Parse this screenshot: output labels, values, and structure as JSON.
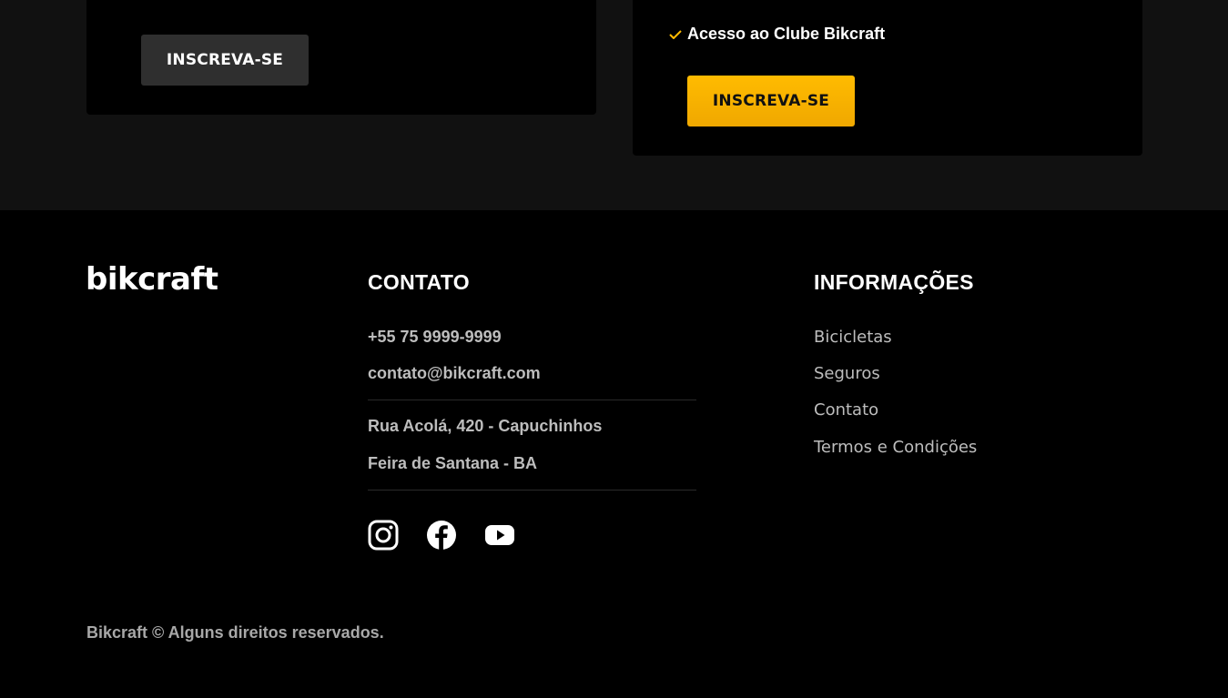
{
  "plans": {
    "left_button": "INSCREVA-SE",
    "right_benefit": "Acesso ao Clube Bikcraft",
    "right_button": "INSCREVA-SE"
  },
  "footer": {
    "logo": "bikcraft",
    "contato": {
      "title": "CONTATO",
      "phone": "+55 75 9999-9999",
      "email": "contato@bikcraft.com",
      "address_line1": "Rua Acolá, 420 - Capuchinhos",
      "address_line2": "Feira de Santana - BA"
    },
    "social": [
      "instagram-icon",
      "facebook-icon",
      "youtube-icon"
    ],
    "info": {
      "title": "INFORMAÇÕES",
      "links": [
        "Bicicletas",
        "Seguros",
        "Contato",
        "Termos e Condições"
      ]
    },
    "copyright": "Bikcraft © Alguns direitos reservados."
  },
  "colors": {
    "accent": "#FFBB00",
    "background": "#000000",
    "section_bg": "#111111",
    "muted_text": "#BDBDBD"
  }
}
